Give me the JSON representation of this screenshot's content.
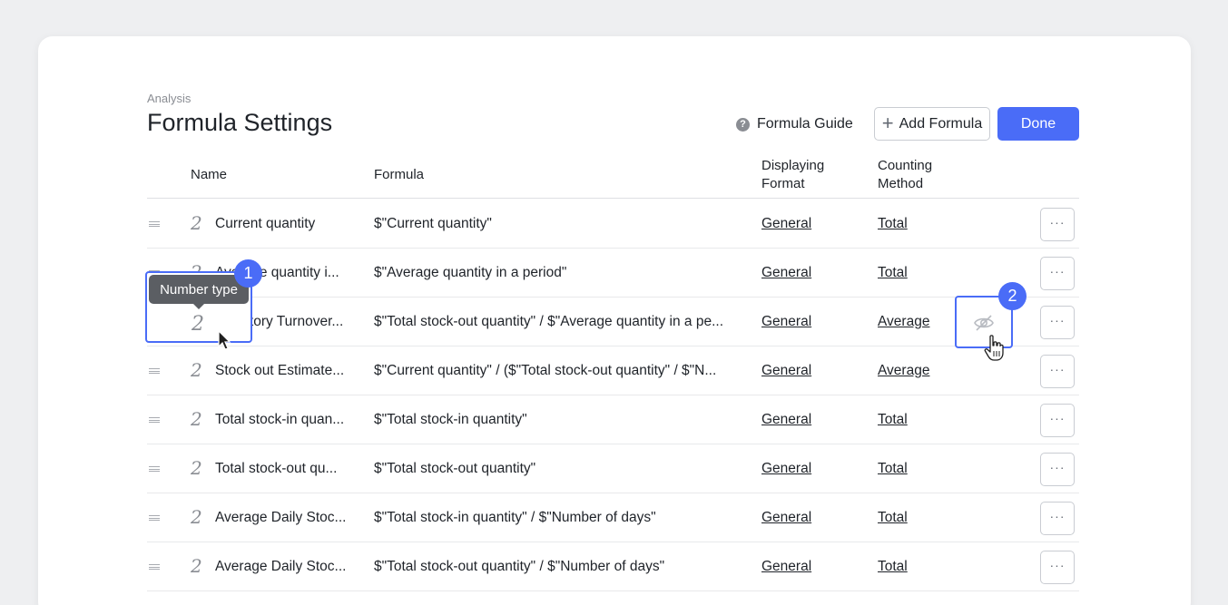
{
  "header": {
    "breadcrumb": "Analysis",
    "title": "Formula Settings",
    "guide_label": "Formula Guide",
    "add_label": "Add Formula",
    "done_label": "Done"
  },
  "columns": {
    "name": "Name",
    "formula": "Formula",
    "display": "Displaying Format",
    "count": "Counting Method"
  },
  "rows": [
    {
      "type": "2",
      "name": "Current quantity",
      "formula": "$\"Current quantity\"",
      "display": "General",
      "count": "Total"
    },
    {
      "type": "2",
      "name": "Average quantity i...",
      "formula": "$\"Average quantity in a period\"",
      "display": "General",
      "count": "Total"
    },
    {
      "type": "2",
      "name": "Inventory Turnover...",
      "formula": "$\"Total stock-out quantity\" / $\"Average quantity in a pe...",
      "display": "General",
      "count": "Average"
    },
    {
      "type": "2",
      "name": "Stock out Estimate...",
      "formula": "$\"Current quantity\" / ($\"Total stock-out quantity\" / $\"N...",
      "display": "General",
      "count": "Average"
    },
    {
      "type": "2",
      "name": "Total stock-in quan...",
      "formula": "$\"Total stock-in quantity\"",
      "display": "General",
      "count": "Total"
    },
    {
      "type": "2",
      "name": "Total stock-out qu...",
      "formula": "$\"Total stock-out quantity\"",
      "display": "General",
      "count": "Total"
    },
    {
      "type": "2",
      "name": "Average Daily Stoc...",
      "formula": "$\"Total stock-in quantity\" / $\"Number of days\"",
      "display": "General",
      "count": "Total"
    },
    {
      "type": "2",
      "name": "Average Daily Stoc...",
      "formula": "$\"Total stock-out quantity\" / $\"Number of days\"",
      "display": "General",
      "count": "Total"
    }
  ],
  "callouts": {
    "badge1": "1",
    "badge2": "2",
    "tooltip": "Number type",
    "type_icon": "2"
  },
  "icons": {
    "help": "question-circle-icon",
    "add": "plus-icon",
    "drag": "drag-handle-icon",
    "more": "ellipsis-icon",
    "hide": "eye-off-icon"
  },
  "colors": {
    "accent": "#4a6cf7",
    "tooltip_bg": "#5b5e63"
  }
}
